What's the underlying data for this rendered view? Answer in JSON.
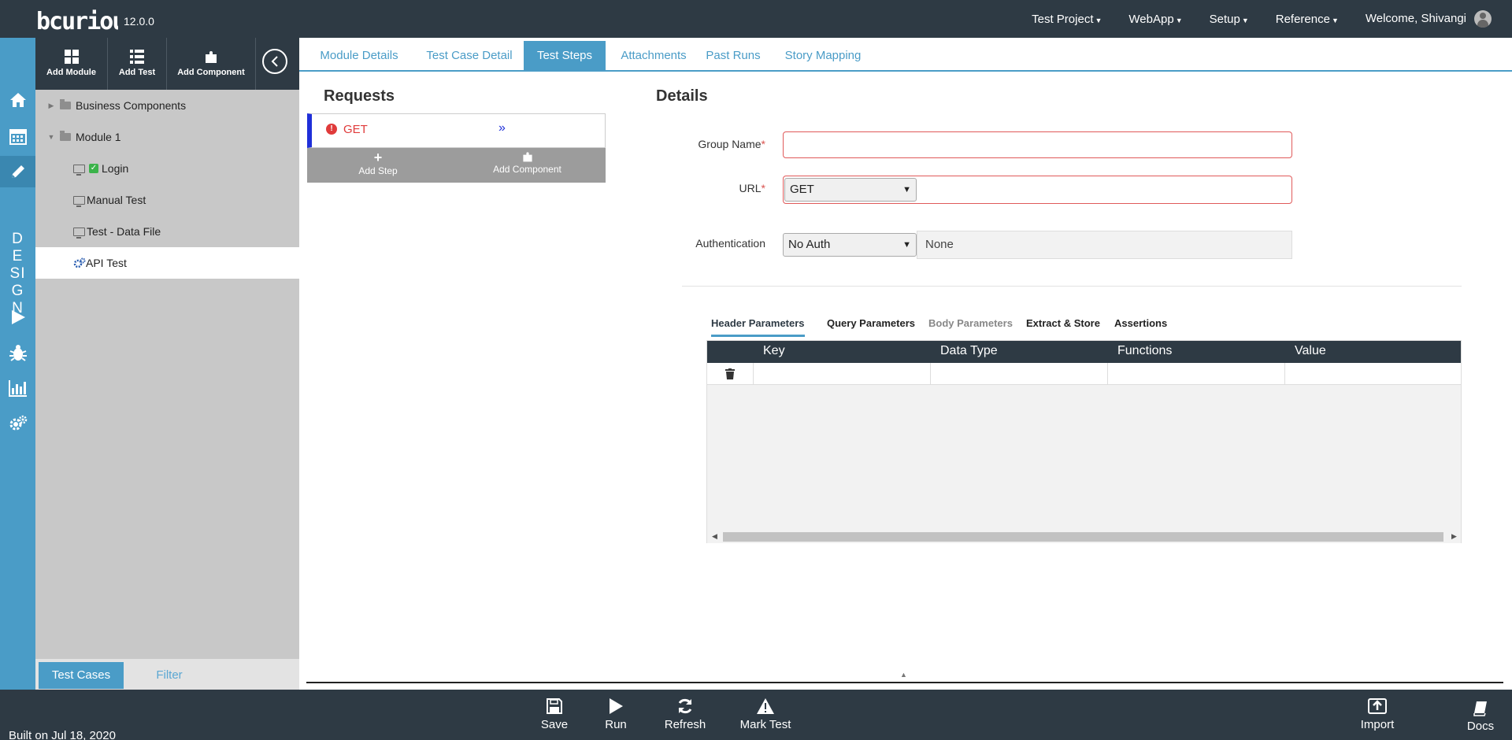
{
  "app": {
    "logo_text": "bcurious",
    "version": "12.0.0"
  },
  "topnav": {
    "items": [
      {
        "label": "Test Project"
      },
      {
        "label": "WebApp"
      },
      {
        "label": "Setup"
      },
      {
        "label": "Reference"
      }
    ],
    "welcome": "Welcome, Shivangi"
  },
  "rail": {
    "icons": [
      "home-icon",
      "calendar-icon",
      "pencil-icon",
      "play-icon",
      "bug-icon",
      "bar-chart-icon",
      "gears-icon"
    ],
    "design_label": [
      "D",
      "E",
      "SI",
      "G",
      "N"
    ]
  },
  "toolbar": {
    "add_module": "Add Module",
    "add_test": "Add Test",
    "add_component": "Add Component"
  },
  "tree": {
    "items": [
      {
        "label": "Business Components"
      },
      {
        "label": "Module 1"
      },
      {
        "label": "Login"
      },
      {
        "label": "Manual Test"
      },
      {
        "label": "Test - Data File"
      },
      {
        "label": "API Test"
      }
    ]
  },
  "bottom_tabs": {
    "test_cases": "Test Cases",
    "filter": "Filter"
  },
  "tabs": {
    "items": [
      {
        "label": "Module Details"
      },
      {
        "label": "Test Case Detail"
      },
      {
        "label": "Test Steps"
      },
      {
        "label": "Attachments"
      },
      {
        "label": "Past Runs"
      },
      {
        "label": "Story Mapping"
      }
    ],
    "active": "Test Steps"
  },
  "requests": {
    "title": "Requests",
    "item_method": "GET",
    "add_step": "Add Step",
    "add_component": "Add Component"
  },
  "details": {
    "title": "Details",
    "group_name_label": "Group Name",
    "group_name_value": "",
    "url_label": "URL",
    "url_method": "GET",
    "url_value": "",
    "auth_label": "Authentication",
    "auth_type": "No Auth",
    "auth_value": "None",
    "required_mark": "*"
  },
  "param_tabs": {
    "header": "Header Parameters",
    "query": "Query Parameters",
    "body": "Body Parameters",
    "extract": "Extract & Store",
    "assertions": "Assertions"
  },
  "grid": {
    "columns": [
      "Key",
      "Data Type",
      "Functions",
      "Value"
    ],
    "rows": [
      {
        "key": "",
        "data_type": "",
        "functions": "",
        "value": ""
      }
    ]
  },
  "footer": {
    "save": "Save",
    "run": "Run",
    "refresh": "Refresh",
    "mark_test": "Mark Test",
    "import": "Import",
    "docs": "Docs",
    "built": "Built on Jul 18, 2020"
  }
}
